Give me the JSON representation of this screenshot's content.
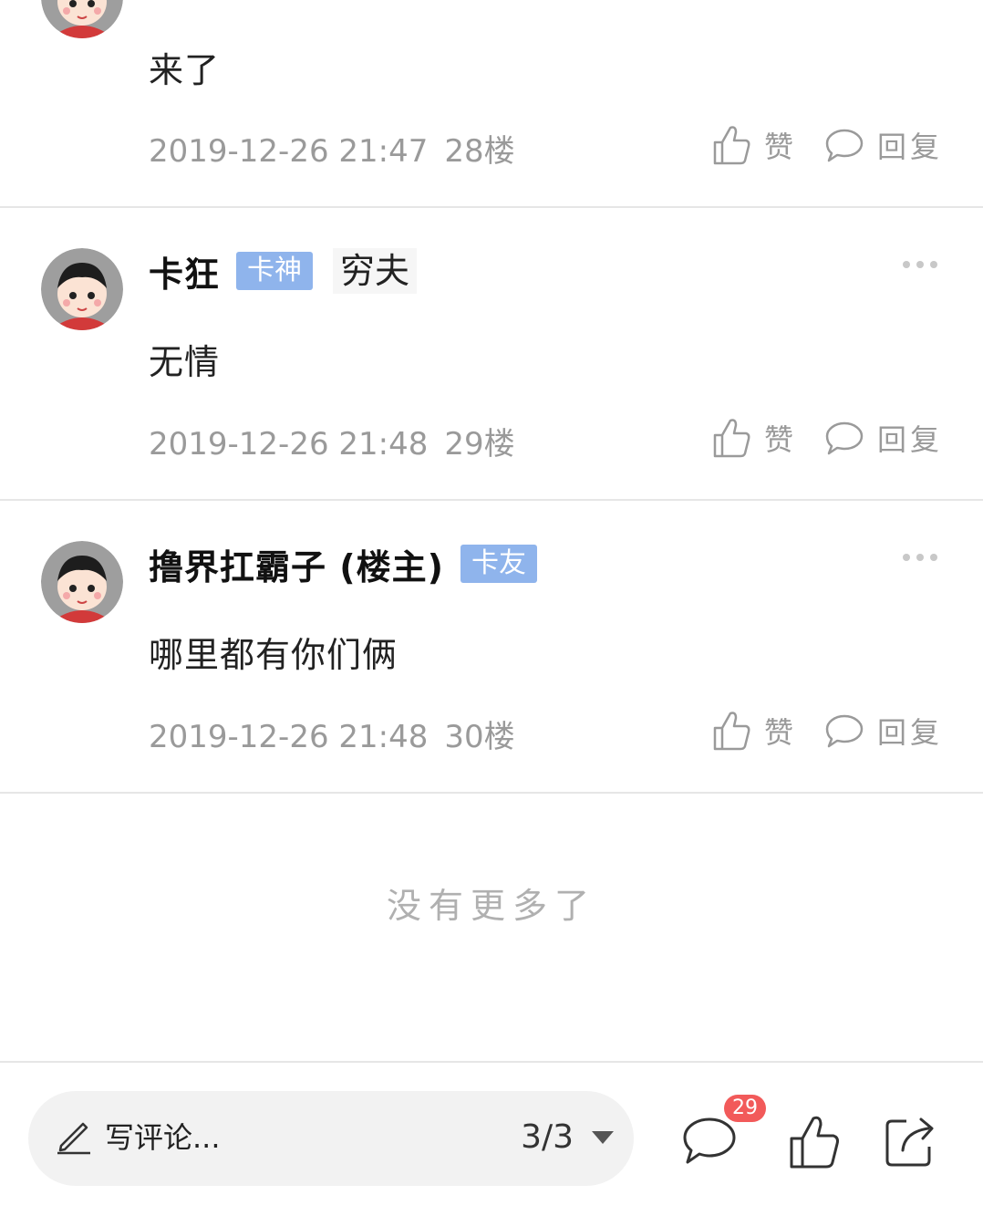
{
  "posts": [
    {
      "username": "",
      "content": "来了",
      "time": "2019-12-26 21:47",
      "floor": "28楼",
      "like_label": "赞",
      "reply_label": "回复"
    },
    {
      "username": "卡狂",
      "badge": "卡神",
      "title_chip": "穷夫",
      "content": "无情",
      "time": "2019-12-26 21:48",
      "floor": "29楼",
      "like_label": "赞",
      "reply_label": "回复"
    },
    {
      "username": "撸界扛霸子 (楼主)",
      "badge": "卡友",
      "content": "哪里都有你们俩",
      "time": "2019-12-26 21:48",
      "floor": "30楼",
      "like_label": "赞",
      "reply_label": "回复"
    }
  ],
  "end_of_list": "没有更多了",
  "bottom_bar": {
    "comment_placeholder": "写评论...",
    "page_indicator": "3/3",
    "comment_count": "29",
    "icons": [
      "pencil-icon",
      "caret-down-icon",
      "comment-icon",
      "like-icon",
      "share-icon"
    ]
  },
  "colors": {
    "badge": "#8fb4ec",
    "meta_text": "#9a9a9a",
    "count_badge": "#f25a5a"
  }
}
